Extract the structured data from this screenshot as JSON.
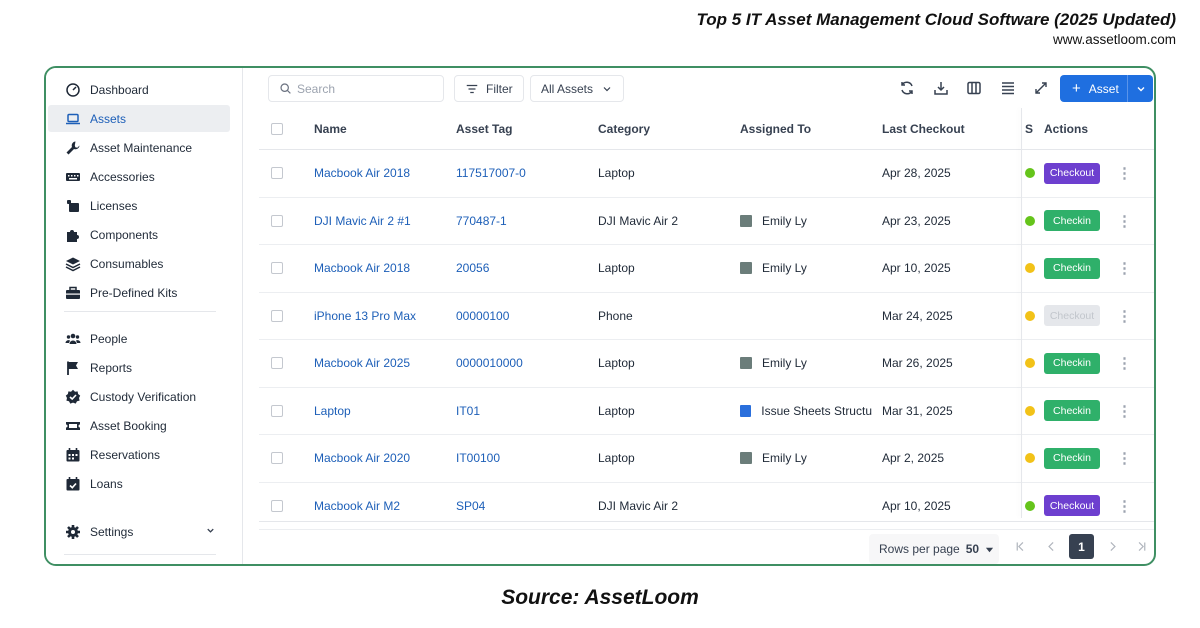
{
  "header": {
    "title": "Top 5 IT Asset Management Cloud Software (2025 Updated)",
    "url": "www.assetloom.com"
  },
  "source_caption": "Source: AssetLoom",
  "sidebar": {
    "items": [
      {
        "label": "Dashboard",
        "icon": "dashboard-icon"
      },
      {
        "label": "Assets",
        "icon": "laptop-icon"
      },
      {
        "label": "Asset Maintenance",
        "icon": "wrench-icon"
      },
      {
        "label": "Accessories",
        "icon": "keyboard-icon"
      },
      {
        "label": "Licenses",
        "icon": "license-icon"
      },
      {
        "label": "Components",
        "icon": "puzzle-icon"
      },
      {
        "label": "Consumables",
        "icon": "layers-icon"
      },
      {
        "label": "Pre-Defined Kits",
        "icon": "toolbox-icon"
      },
      {
        "label": "People",
        "icon": "people-icon"
      },
      {
        "label": "Reports",
        "icon": "flag-icon"
      },
      {
        "label": "Custody Verification",
        "icon": "badge-check-icon"
      },
      {
        "label": "Asset Booking",
        "icon": "ticket-icon"
      },
      {
        "label": "Reservations",
        "icon": "calendar-icon"
      },
      {
        "label": "Loans",
        "icon": "calendar-check-icon"
      },
      {
        "label": "Settings",
        "icon": "gear-icon"
      }
    ],
    "active": "Assets"
  },
  "toolbar": {
    "search_placeholder": "Search",
    "filter_label": "Filter",
    "view_select": "All Assets",
    "add_label": "Asset"
  },
  "table": {
    "columns": [
      "Name",
      "Asset Tag",
      "Category",
      "Assigned To",
      "Last Checkout",
      "S",
      "Actions"
    ],
    "rows": [
      {
        "name": "Macbook Air 2018",
        "tag": "117517007-0",
        "category": "Laptop",
        "assigned": "",
        "avatar": "",
        "checkout": "Apr 28, 2025",
        "status_color": "#65c41b",
        "action": "Checkout",
        "action_color": "#6d3fcf"
      },
      {
        "name": "DJI Mavic Air 2 #1",
        "tag": "770487-1",
        "category": "DJI Mavic Air 2",
        "assigned": "Emily Ly",
        "avatar": "photo",
        "checkout": "Apr 23, 2025",
        "status_color": "#65c41b",
        "action": "Checkin",
        "action_color": "#2fb06a"
      },
      {
        "name": "Macbook Air 2018",
        "tag": "20056",
        "category": "Laptop",
        "assigned": "Emily Ly",
        "avatar": "photo",
        "checkout": "Apr 10, 2025",
        "status_color": "#f2c218",
        "action": "Checkin",
        "action_color": "#2fb06a"
      },
      {
        "name": "iPhone 13 Pro Max",
        "tag": "00000100",
        "category": "Phone",
        "assigned": "",
        "avatar": "",
        "checkout": "Mar 24, 2025",
        "status_color": "#f2c218",
        "action": "Checkout",
        "action_color": "#e5e7eb"
      },
      {
        "name": "Macbook Air 2025",
        "tag": "0000010000",
        "category": "Laptop",
        "assigned": "Emily Ly",
        "avatar": "photo",
        "checkout": "Mar 26, 2025",
        "status_color": "#f2c218",
        "action": "Checkin",
        "action_color": "#2fb06a"
      },
      {
        "name": "Laptop",
        "tag": "IT01",
        "category": "Laptop",
        "assigned": "Issue Sheets Structu",
        "avatar": "sheet",
        "checkout": "Mar 31, 2025",
        "status_color": "#f2c218",
        "action": "Checkin",
        "action_color": "#2fb06a"
      },
      {
        "name": "Macbook Air 2020",
        "tag": "IT00100",
        "category": "Laptop",
        "assigned": "Emily Ly",
        "avatar": "photo",
        "checkout": "Apr 2, 2025",
        "status_color": "#f2c218",
        "action": "Checkin",
        "action_color": "#2fb06a"
      },
      {
        "name": "Macbook Air M2",
        "tag": "SP04",
        "category": "DJI Mavic Air 2",
        "assigned": "",
        "avatar": "",
        "checkout": "Apr 10, 2025",
        "status_color": "#65c41b",
        "action": "Checkout",
        "action_color": "#6d3fcf"
      }
    ]
  },
  "pagination": {
    "rows_per_page_label": "Rows per page",
    "rows_per_page_value": "50",
    "current_page": "1"
  }
}
